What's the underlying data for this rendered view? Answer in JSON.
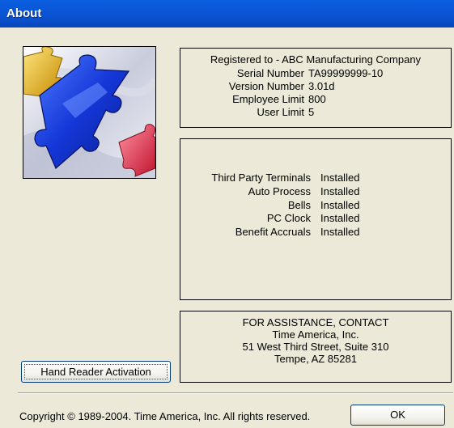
{
  "window": {
    "title": "About"
  },
  "logo": {
    "icon": "puzzle-pieces-logo",
    "colors": [
      "#1a3fd6",
      "#e8b820",
      "#e0304a"
    ]
  },
  "registration": {
    "registered_to": "Registered to - ABC Manufacturing Company",
    "fields": [
      {
        "label": "Serial Number",
        "value": "TA99999999-10"
      },
      {
        "label": "Version Number",
        "value": "3.01d"
      },
      {
        "label": "Employee Limit",
        "value": "800"
      },
      {
        "label": "User Limit",
        "value": "5"
      }
    ]
  },
  "features": [
    {
      "label": "Third Party Terminals",
      "value": "Installed"
    },
    {
      "label": "Auto Process",
      "value": "Installed"
    },
    {
      "label": "Bells",
      "value": "Installed"
    },
    {
      "label": "PC Clock",
      "value": "Installed"
    },
    {
      "label": "Benefit Accruals",
      "value": "Installed"
    }
  ],
  "contact": {
    "heading": "FOR ASSISTANCE, CONTACT",
    "company": "Time America, Inc.",
    "street": "51 West Third Street, Suite 310",
    "city": "Tempe, AZ 85281"
  },
  "buttons": {
    "hand_reader": "Hand Reader Activation",
    "ok": "OK"
  },
  "copyright": "Copyright © 1989-2004.  Time America, Inc.  All rights reserved."
}
